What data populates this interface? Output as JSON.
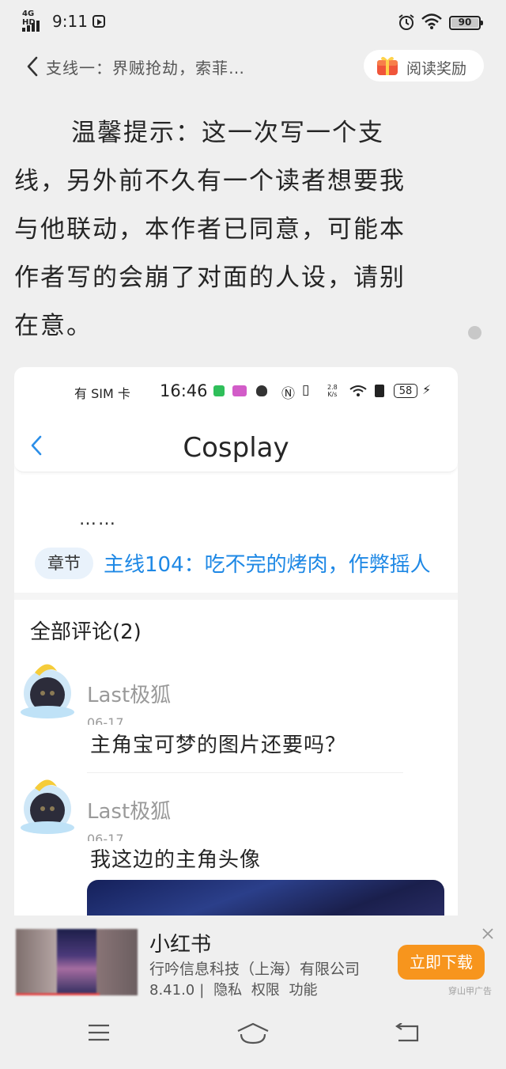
{
  "status_bar": {
    "network": "4G HD",
    "time": "9:11",
    "battery": "90"
  },
  "header": {
    "title": "支线一：界贼抢劫，索菲…",
    "reward_label": "阅读奖励"
  },
  "article": {
    "paragraph": "温馨提示：这一次写一个支线，另外前不久有一个读者想要我与他联动，本作者已同意，可能本作者写的会崩了对面的人设，请别在意。",
    "lines": [
      "温馨提示：这一次写一个支",
      "线，另外前不久有一个读者想要我",
      "与他联动，本作者已同意，可能本",
      "作者写的会崩了对面的人设，请别",
      "在意。"
    ]
  },
  "embedded": {
    "status_bar": {
      "sim": "有 SIM 卡",
      "time": "16:46",
      "rate_value": "2.8",
      "rate_unit": "K/s",
      "battery": "58"
    },
    "app_bar_title": "Cosplay",
    "ellipsis": "……",
    "chapter_badge": "章节",
    "chapter_link": "主线104：吃不完的烤肉，作弊摇人",
    "comments_header": "全部评论(2)",
    "comments": [
      {
        "author": "Last极狐",
        "date": "06-17",
        "text": "主角宝可梦的图片还要吗？"
      },
      {
        "author": "Last极狐",
        "date": "06-17",
        "text": "我这边的主角头像"
      }
    ]
  },
  "ad": {
    "app_name": "小红书",
    "company": "行吟信息科技（上海）有限公司",
    "version": "8.41.0",
    "links": [
      "隐私",
      "权限",
      "功能"
    ],
    "cta": "立即下载",
    "label": "穿山甲广告"
  },
  "colors": {
    "background": "#efefef",
    "link_blue": "#1e88e5",
    "ad_button": "#f7951d",
    "reward_icon": "#f0553a"
  },
  "icons": [
    "back-chevron-icon",
    "gift-icon",
    "alarm-icon",
    "wifi-icon",
    "battery-icon",
    "close-icon",
    "menu-icon",
    "home-icon",
    "return-icon"
  ]
}
